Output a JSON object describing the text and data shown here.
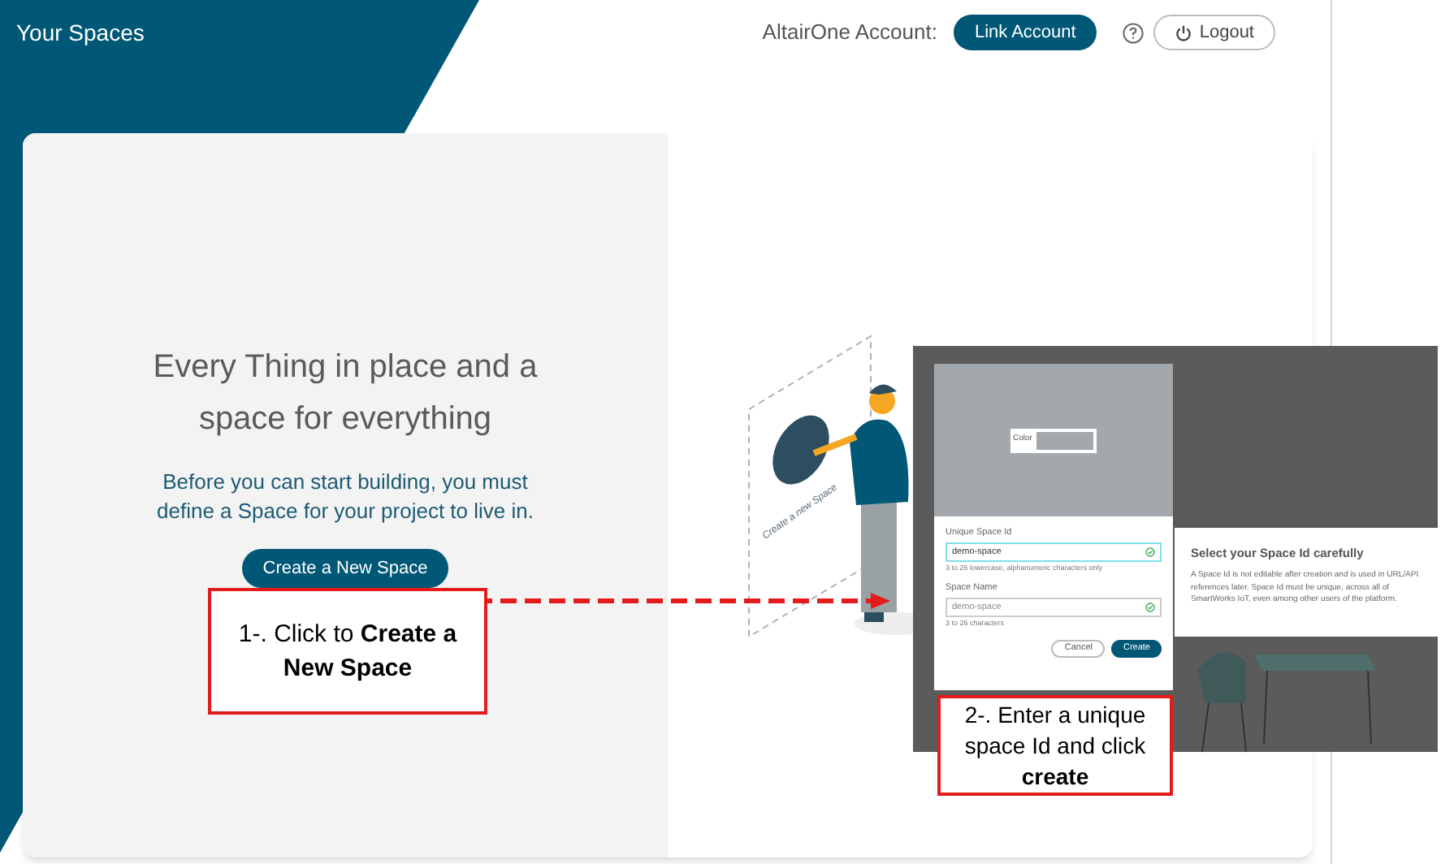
{
  "header": {
    "title": "Your Spaces",
    "account_label": "AltairOne Account:",
    "link_button": "Link Account",
    "logout_button": "Logout"
  },
  "hero": {
    "heading": "Every Thing in place and a space for everything",
    "description": "Before you can start building, you must define a Space for your project to live in.",
    "create_button": "Create a New Space"
  },
  "illustration": {
    "caption": "Create a new Space"
  },
  "inset": {
    "color_label": "Color",
    "fields": [
      {
        "label": "Unique Space Id",
        "value": "demo-space",
        "hint": "3 to 26 lowercase, alphanumeric characters only",
        "valid": true,
        "focused": true
      },
      {
        "label": "Space Name",
        "value": "demo-space",
        "hint": "3 to 26 characters",
        "valid": true,
        "focused": false
      }
    ],
    "cancel_button": "Cancel",
    "create_button": "Create",
    "tip": {
      "title": "Select your Space Id carefully",
      "body": "A Space Id is not editable after creation and is used in URL/API references later. Space Id must be unique, across all of SmartWorks IoT, even among other users of the platform."
    }
  },
  "callouts": [
    {
      "text": "1-. Click to **Create a New Space**"
    },
    {
      "text": "2-. Enter a unique space Id and click **create**"
    }
  ]
}
